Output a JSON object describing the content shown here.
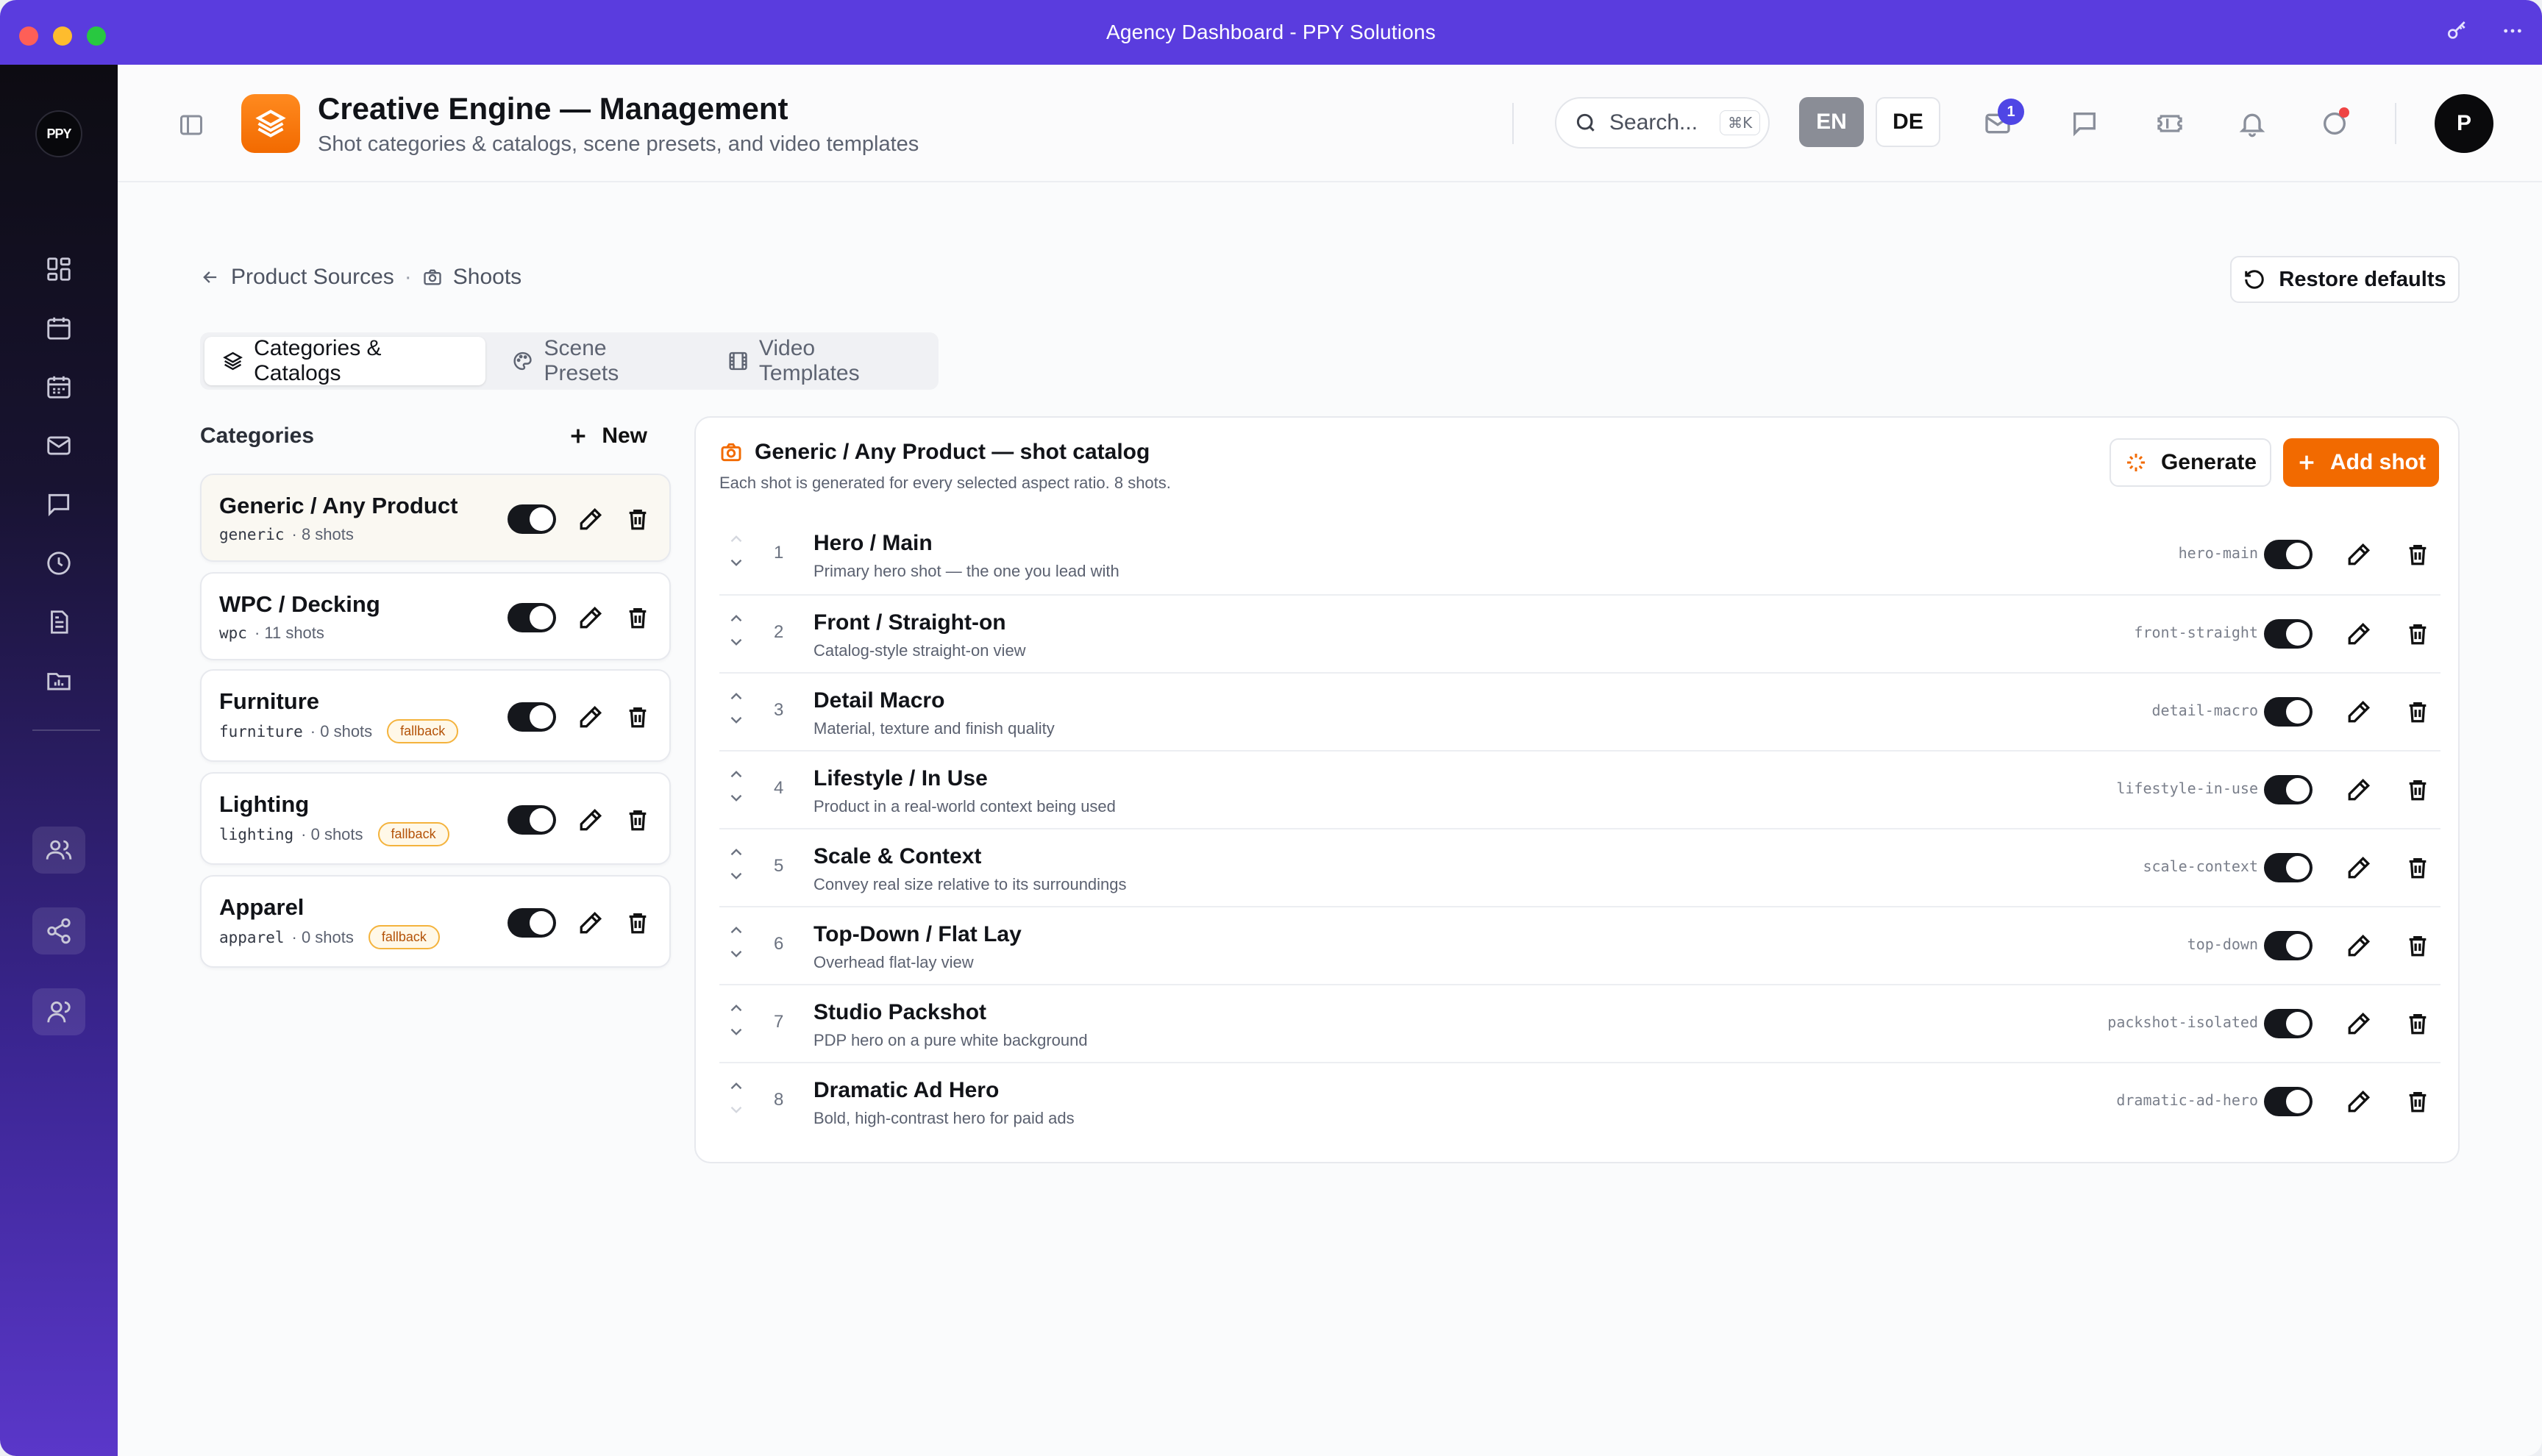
{
  "window": {
    "title": "Agency Dashboard - PPY Solutions"
  },
  "rail": {
    "logo_text": "PPY"
  },
  "header": {
    "title": "Creative Engine — Management",
    "subtitle": "Shot categories & catalogs, scene presets, and video templates",
    "search_placeholder": "Search...",
    "search_shortcut": "⌘K",
    "lang_en": "EN",
    "lang_de": "DE",
    "mail_badge": "1",
    "avatar_initial": "P"
  },
  "breadcrumb": {
    "back_label": "Product Sources",
    "current_label": "Shoots"
  },
  "restore_label": "Restore defaults",
  "tabs": [
    {
      "label": "Categories & Catalogs",
      "active": true
    },
    {
      "label": "Scene Presets",
      "active": false
    },
    {
      "label": "Video Templates",
      "active": false
    }
  ],
  "categories": {
    "heading": "Categories",
    "new_label": "New",
    "items": [
      {
        "name": "Generic / Any Product",
        "slug": "generic",
        "count": "· 8 shots",
        "fallback": "",
        "enabled": true,
        "selected": true
      },
      {
        "name": "WPC / Decking",
        "slug": "wpc",
        "count": "· 11 shots",
        "fallback": "",
        "enabled": true,
        "selected": false
      },
      {
        "name": "Furniture",
        "slug": "furniture",
        "count": "· 0 shots",
        "fallback": "fallback",
        "enabled": true,
        "selected": false
      },
      {
        "name": "Lighting",
        "slug": "lighting",
        "count": "· 0 shots",
        "fallback": "fallback",
        "enabled": true,
        "selected": false
      },
      {
        "name": "Apparel",
        "slug": "apparel",
        "count": "· 0 shots",
        "fallback": "fallback",
        "enabled": true,
        "selected": false
      }
    ]
  },
  "catalog": {
    "title": "Generic / Any Product — shot catalog",
    "subtitle": "Each shot is generated for every selected aspect ratio. 8 shots.",
    "generate_label": "Generate",
    "add_label": "Add shot",
    "shots": [
      {
        "index": "1",
        "name": "Hero / Main",
        "desc": "Primary hero shot — the one you lead with",
        "slug": "hero-main",
        "enabled": true
      },
      {
        "index": "2",
        "name": "Front / Straight-on",
        "desc": "Catalog-style straight-on view",
        "slug": "front-straight",
        "enabled": true
      },
      {
        "index": "3",
        "name": "Detail Macro",
        "desc": "Material, texture and finish quality",
        "slug": "detail-macro",
        "enabled": true
      },
      {
        "index": "4",
        "name": "Lifestyle / In Use",
        "desc": "Product in a real-world context being used",
        "slug": "lifestyle-in-use",
        "enabled": true
      },
      {
        "index": "5",
        "name": "Scale & Context",
        "desc": "Convey real size relative to its surroundings",
        "slug": "scale-context",
        "enabled": true
      },
      {
        "index": "6",
        "name": "Top-Down / Flat Lay",
        "desc": "Overhead flat-lay view",
        "slug": "top-down",
        "enabled": true
      },
      {
        "index": "7",
        "name": "Studio Packshot",
        "desc": "PDP hero on a pure white background",
        "slug": "packshot-isolated",
        "enabled": true
      },
      {
        "index": "8",
        "name": "Dramatic Ad Hero",
        "desc": "Bold, high-contrast hero for paid ads",
        "slug": "dramatic-ad-hero",
        "enabled": true
      }
    ]
  }
}
